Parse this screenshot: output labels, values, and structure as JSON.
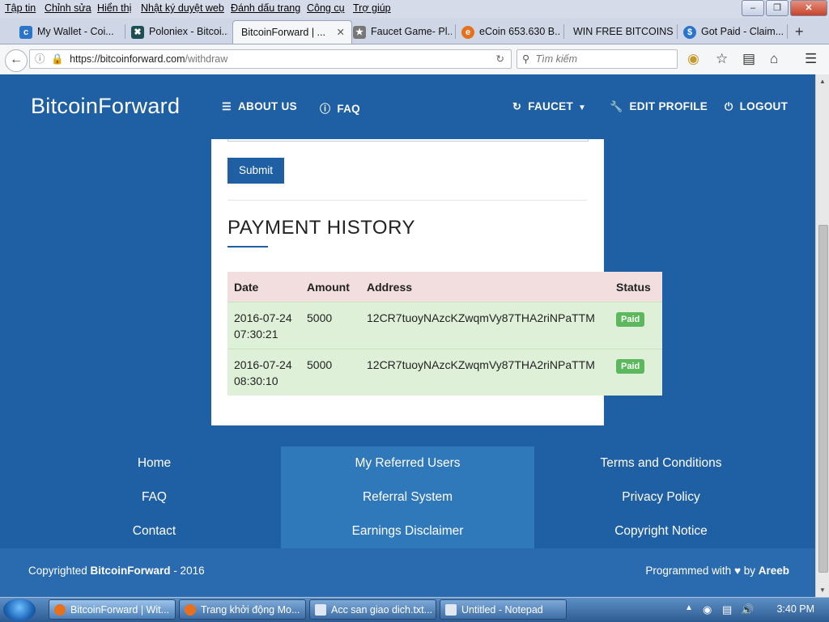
{
  "browser": {
    "menu": [
      "Tập tin",
      "Chỉnh sửa",
      "Hiển thị",
      "Nhật ký duyệt web",
      "Đánh dấu trang",
      "Công cụ",
      "Trợ giúp"
    ],
    "tabs": [
      {
        "label": "My Wallet - Coi...",
        "icon": "coinbase-icon"
      },
      {
        "label": "Poloniex - Bitcoi...",
        "icon": "poloniex-icon"
      },
      {
        "label": "BitcoinForward | ...",
        "icon": "none",
        "active": true
      },
      {
        "label": "Faucet Game- Pl...",
        "icon": "faucet-icon"
      },
      {
        "label": "eCoin 653.630 B...",
        "icon": "ecoin-icon"
      },
      {
        "label": "WIN FREE BITCOINS",
        "icon": "none"
      },
      {
        "label": "Got Paid - Claim...",
        "icon": "gotpaid-icon"
      }
    ],
    "url_host": "https://bitcoinforward.com",
    "url_path": "/withdraw",
    "search_placeholder": "Tìm kiếm"
  },
  "site": {
    "logo": "BitcoinForward",
    "nav": {
      "about": "ABOUT US",
      "faq": "FAQ",
      "faucet": "FAUCET",
      "edit_profile": "EDIT PROFILE",
      "logout": "LOGOUT"
    }
  },
  "withdraw": {
    "submit_label": "Submit",
    "history_title": "PAYMENT HISTORY",
    "columns": [
      "Date",
      "Amount",
      "Address",
      "Status"
    ],
    "rows": [
      {
        "date": "2016-07-24",
        "time": "07:30:21",
        "amount": "5000",
        "address": "12CR7tuoyNAzcKZwqmVy87THA2riNPaTTM",
        "status": "Paid"
      },
      {
        "date": "2016-07-24",
        "time": "08:30:10",
        "amount": "5000",
        "address": "12CR7tuoyNAzcKZwqmVy87THA2riNPaTTM",
        "status": "Paid"
      }
    ]
  },
  "footer": {
    "col1": [
      "Home",
      "FAQ",
      "Contact"
    ],
    "col2": [
      "My Referred Users",
      "Referral System",
      "Earnings Disclaimer"
    ],
    "col3": [
      "Terms and Conditions",
      "Privacy Policy",
      "Copyright Notice"
    ],
    "copy_prefix": "Copyrighted ",
    "copy_brand": "BitcoinForward",
    "copy_suffix": " - 2016",
    "prog_prefix": "Programmed with ",
    "prog_by": " by ",
    "prog_author": "Areeb"
  },
  "taskbar": {
    "tasks": [
      "BitcoinForward | Wit...",
      "Trang khởi động Mo...",
      "Acc san giao dich.txt...",
      "Untitled - Notepad"
    ],
    "clock": "3:40 PM"
  },
  "colors": {
    "brand": "#1f5fa3",
    "header_row": "#f2dede",
    "paid_row": "#dff0d8",
    "badge": "#5cb85c"
  }
}
